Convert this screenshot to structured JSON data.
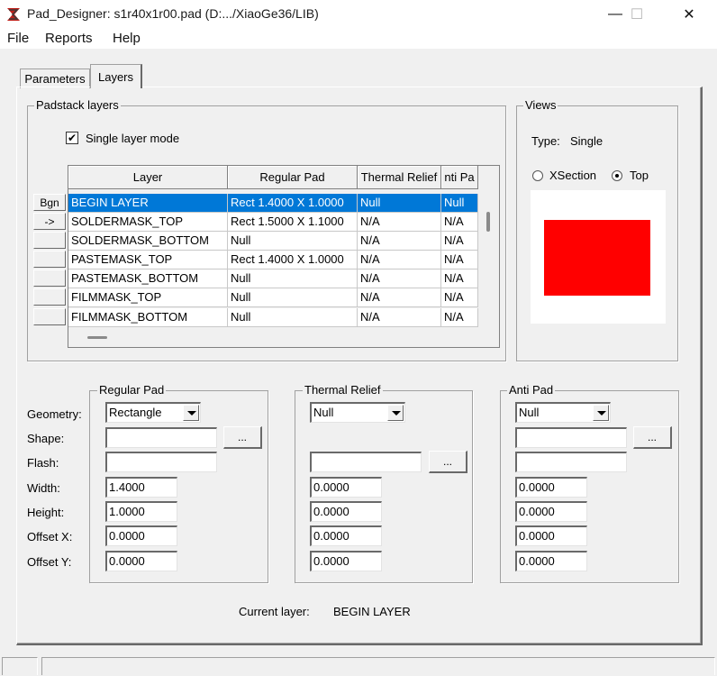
{
  "window": {
    "title": "Pad_Designer: s1r40x1r00.pad (D:.../XiaoGe36/LIB)",
    "minimize_glyph": "—",
    "maximize_glyph": "☐",
    "close_glyph": "✕"
  },
  "menu": [
    "File",
    "Reports",
    "Help"
  ],
  "tabs": [
    {
      "label": "Parameters",
      "active": false
    },
    {
      "label": "Layers",
      "active": true
    }
  ],
  "padstack_layers": {
    "title": "Padstack layers",
    "single_layer_mode_label": "Single layer mode",
    "single_layer_mode_checked": true,
    "checkmark": "✔",
    "columns": [
      "Layer",
      "Regular Pad",
      "Thermal Relief",
      "nti Pa"
    ],
    "row_buttons": [
      "Bgn",
      "->",
      "",
      "",
      "",
      "",
      ""
    ],
    "rows": [
      {
        "layer": "BEGIN LAYER",
        "regular": "Rect 1.4000 X 1.0000",
        "thermal": "Null",
        "anti": "Null",
        "selected": true
      },
      {
        "layer": "SOLDERMASK_TOP",
        "regular": "Rect 1.5000 X 1.1000",
        "thermal": "N/A",
        "anti": "N/A",
        "selected": false
      },
      {
        "layer": "SOLDERMASK_BOTTOM",
        "regular": "Null",
        "thermal": "N/A",
        "anti": "N/A",
        "selected": false
      },
      {
        "layer": "PASTEMASK_TOP",
        "regular": "Rect 1.4000 X 1.0000",
        "thermal": "N/A",
        "anti": "N/A",
        "selected": false
      },
      {
        "layer": "PASTEMASK_BOTTOM",
        "regular": "Null",
        "thermal": "N/A",
        "anti": "N/A",
        "selected": false
      },
      {
        "layer": "FILMMASK_TOP",
        "regular": "Null",
        "thermal": "N/A",
        "anti": "N/A",
        "selected": false
      },
      {
        "layer": "FILMMASK_BOTTOM",
        "regular": "Null",
        "thermal": "N/A",
        "anti": "N/A",
        "selected": false
      }
    ]
  },
  "views": {
    "title": "Views",
    "type_label": "Type:",
    "type_value": "Single",
    "xsection_label": "XSection",
    "top_label": "Top",
    "selected_view": "Top",
    "pad_color": "#ff0000"
  },
  "labels": {
    "geometry": "Geometry:",
    "shape": "Shape:",
    "flash": "Flash:",
    "width": "Width:",
    "height": "Height:",
    "offset_x": "Offset X:",
    "offset_y": "Offset Y:"
  },
  "regular_pad": {
    "title": "Regular Pad",
    "geometry": "Rectangle",
    "shape": "",
    "flash": "",
    "width": "1.4000",
    "height": "1.0000",
    "offset_x": "0.0000",
    "offset_y": "0.0000",
    "ellipsis": "..."
  },
  "thermal_relief": {
    "title": "Thermal Relief",
    "geometry": "Null",
    "flash": "",
    "width": "0.0000",
    "height": "0.0000",
    "offset_x": "0.0000",
    "offset_y": "0.0000",
    "ellipsis": "..."
  },
  "anti_pad": {
    "title": "Anti Pad",
    "geometry": "Null",
    "shape": "",
    "flash": "",
    "width": "0.0000",
    "height": "0.0000",
    "offset_x": "0.0000",
    "offset_y": "0.0000",
    "ellipsis": "..."
  },
  "current_layer": {
    "label": "Current layer:",
    "value": "BEGIN LAYER"
  }
}
